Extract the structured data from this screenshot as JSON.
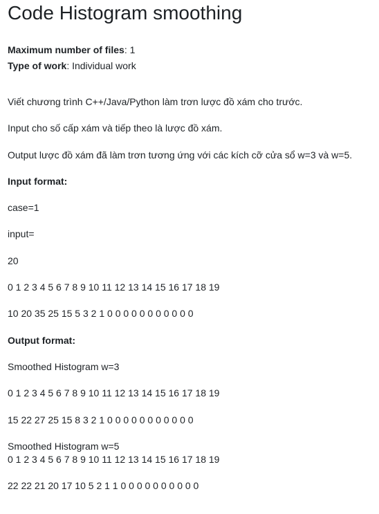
{
  "title": "Code Histogram smoothing",
  "meta": {
    "max_files_label": "Maximum number of files",
    "max_files_value": ": 1",
    "work_type_label": "Type of work",
    "work_type_value": ": Individual work"
  },
  "description": {
    "line1": "Viết chương trình C++/Java/Python làm trơn lược đồ xám cho trước.",
    "line2": "Input cho số cấp xám và tiếp theo là lược đồ xám.",
    "line3": "Output lược đồ xám đã làm trơn tương ứng với các kích cỡ cửa sổ w=3 và w=5.",
    "input_heading": "Input format:",
    "case_line": "case=1",
    "input_line": "input=",
    "levels": "20",
    "indices": "0 1 2 3 4 5 6 7 8 9 10 11 12 13 14 15 16 17 18 19",
    "histogram": "10 20 35 25 15 5 3 2 1 0 0 0 0 0 0 0 0 0 0 0",
    "output_heading": "Output format:",
    "w3_label": "Smoothed Histogram w=3",
    "w3_indices": "0 1 2 3 4 5 6 7 8 9 10 11 12 13 14 15 16 17 18 19",
    "w3_values": "15 22 27 25 15 8 3 2 1 0 0 0 0 0 0 0 0 0 0 0",
    "w5_label": "Smoothed Histogram w=5",
    "w5_indices": "0 1 2 3 4 5 6 7 8 9 10 11 12 13 14 15 16 17 18 19",
    "w5_values": "22 22 21 20 17 10 5 2 1 1 0 0 0 0 0 0 0 0 0 0"
  }
}
